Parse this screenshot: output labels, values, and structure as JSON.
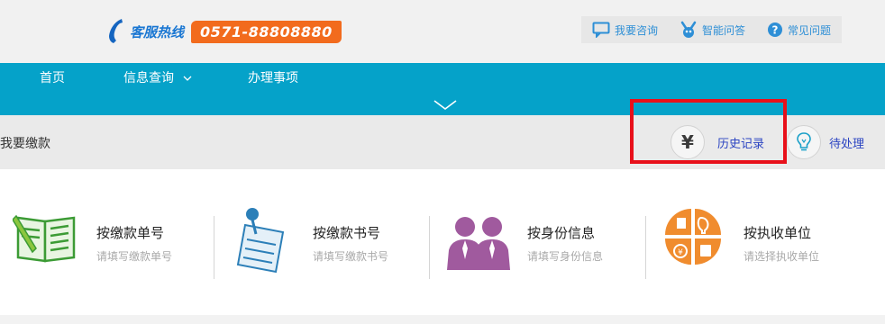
{
  "hotline": {
    "label": "客服热线",
    "number": "0571-88808880"
  },
  "top_links": [
    {
      "label": "我要咨询",
      "icon": "chat-bubble-icon"
    },
    {
      "label": "智能问答",
      "icon": "robot-icon"
    },
    {
      "label": "常见问题",
      "icon": "question-circle-icon"
    }
  ],
  "nav": {
    "home": "首页",
    "info_query": "信息查询",
    "tasks": "办理事项"
  },
  "page_title": "我要缴款",
  "actions": {
    "history": "历史记录",
    "pending": "待处理"
  },
  "options": [
    {
      "title": "按缴款单号",
      "subtitle": "请填写缴款单号",
      "icon": "notebook-pen-icon"
    },
    {
      "title": "按缴款书号",
      "subtitle": "请填写缴款书号",
      "icon": "pinned-document-icon"
    },
    {
      "title": "按身份信息",
      "subtitle": "请填写身份信息",
      "icon": "people-icon"
    },
    {
      "title": "按执收单位",
      "subtitle": "请选择执收单位",
      "icon": "unit-grid-icon"
    }
  ],
  "colors": {
    "nav_bg": "#05a2c9",
    "hotline_number_bg": "#f26b1d",
    "highlight": "#e8101a",
    "link": "#2b44c2"
  }
}
